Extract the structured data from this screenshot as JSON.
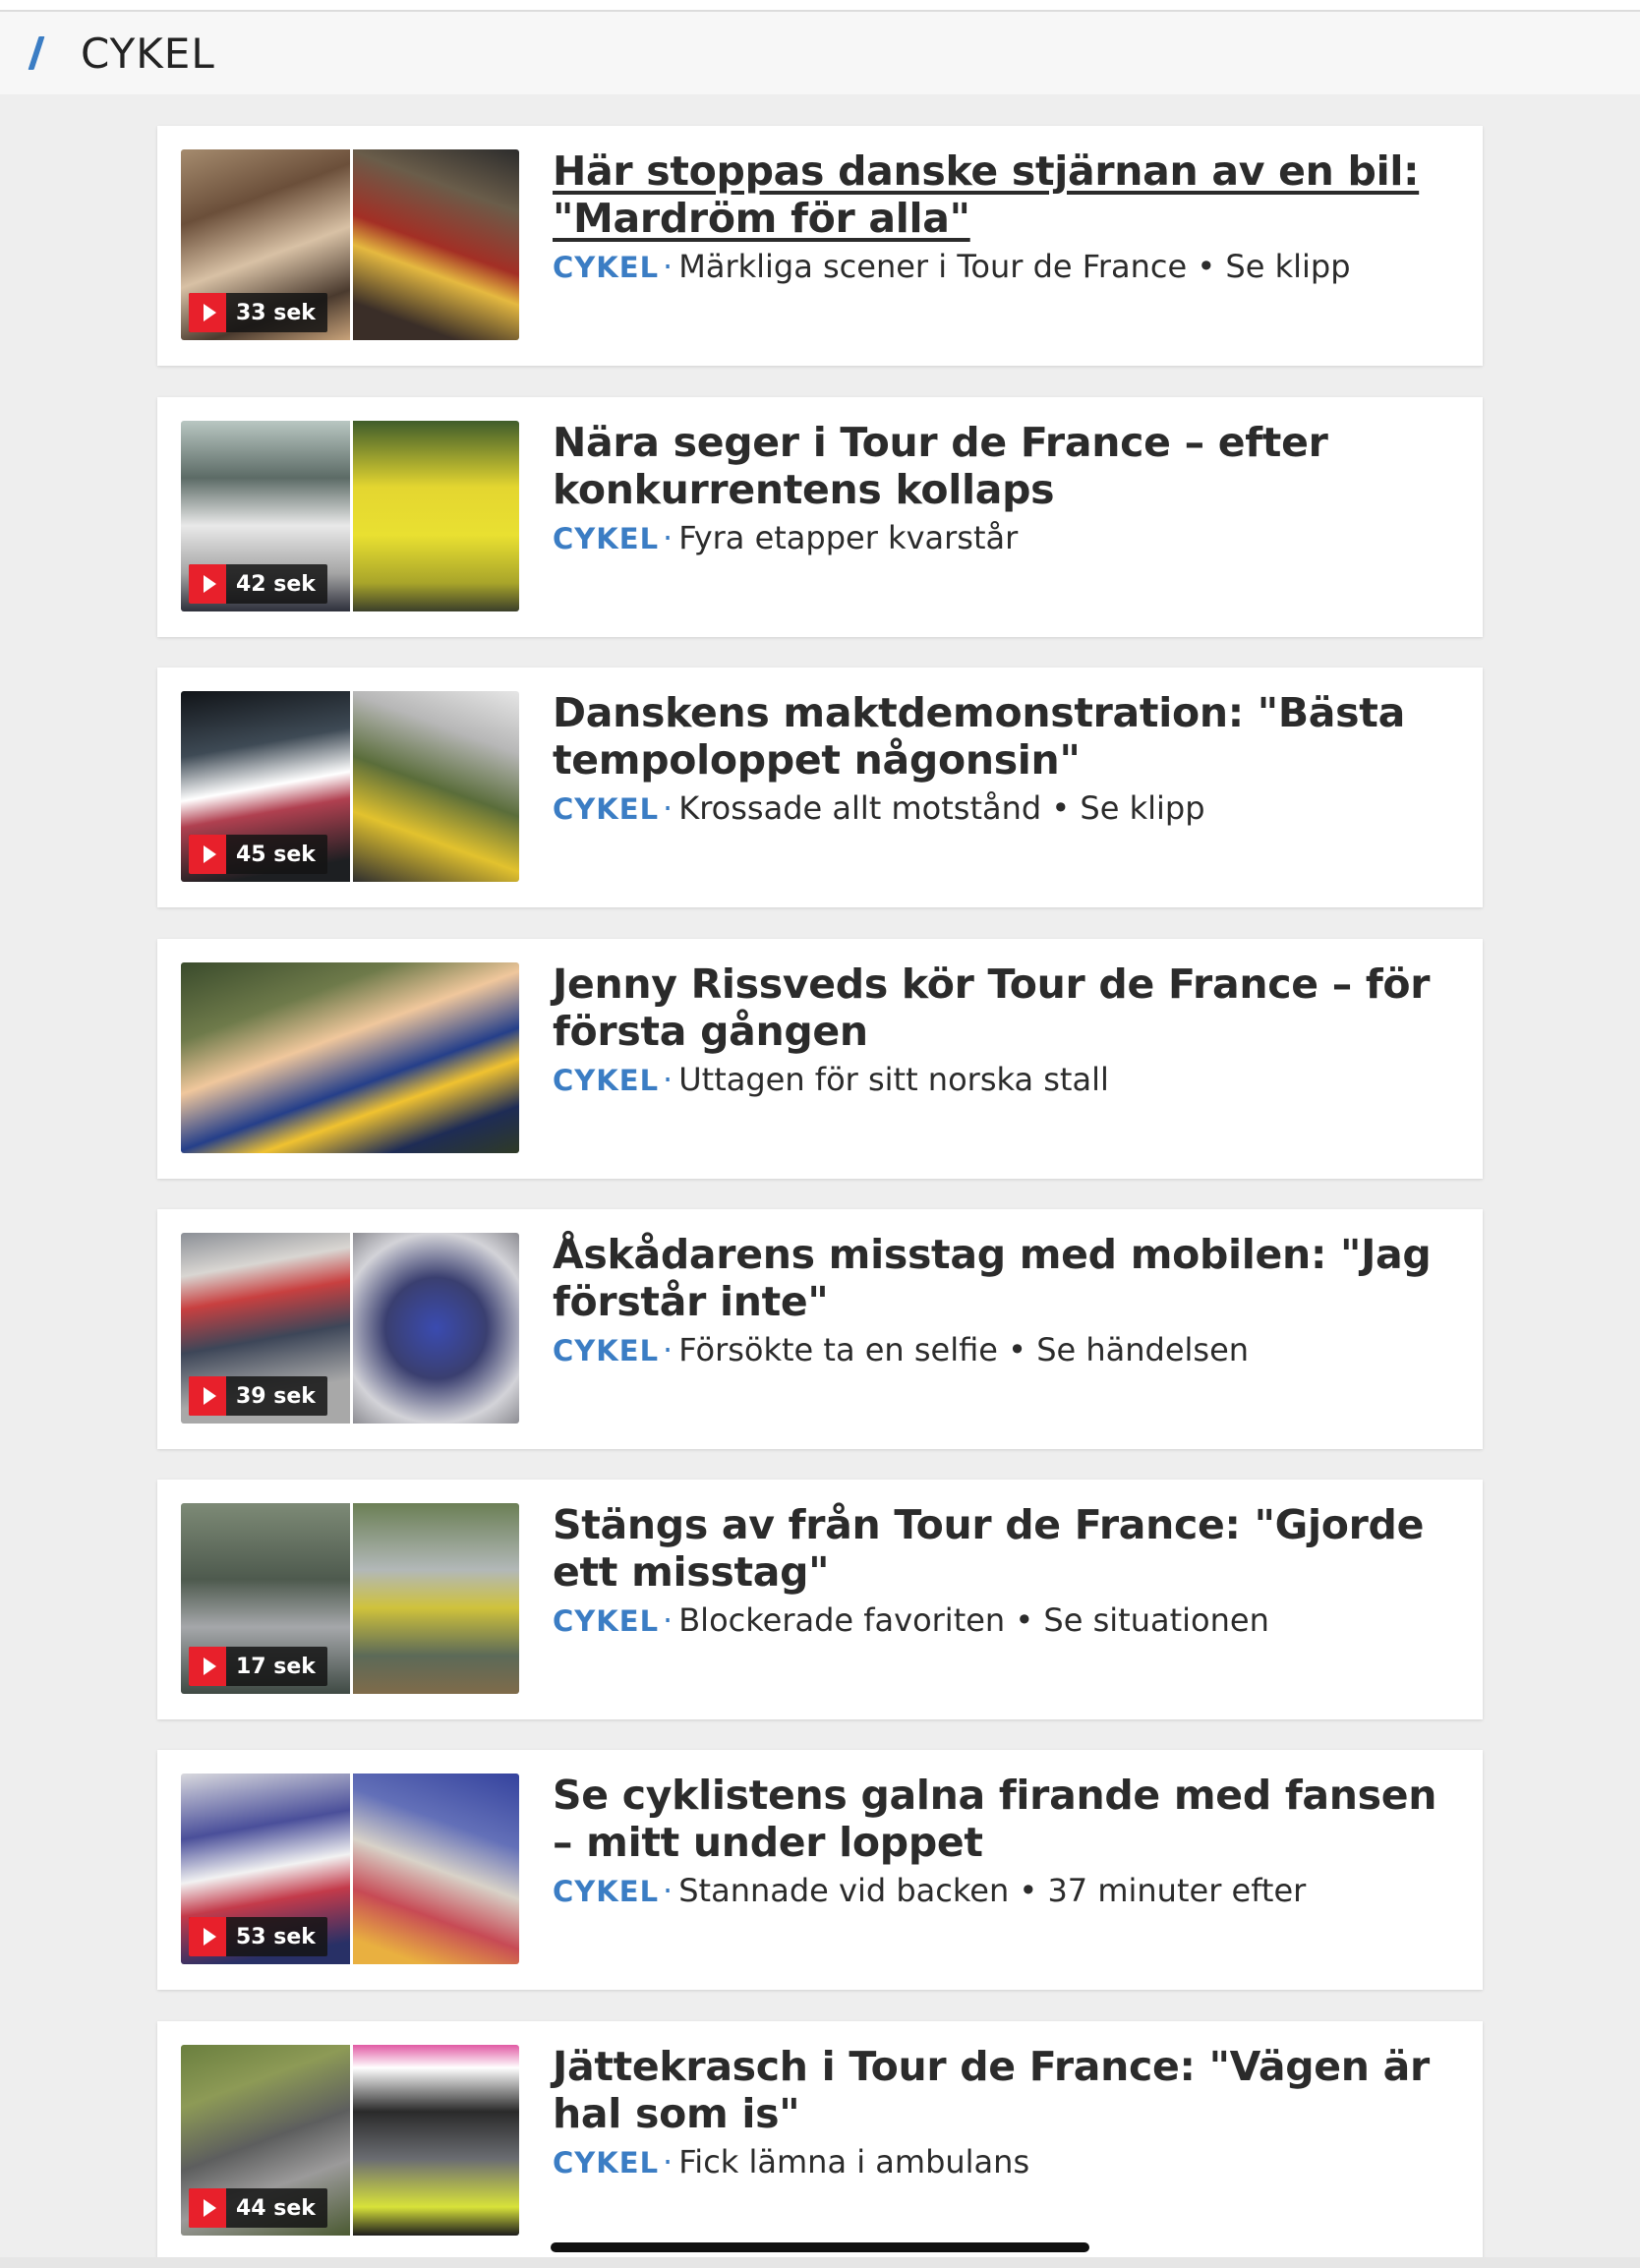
{
  "section": {
    "title": "CYKEL"
  },
  "articles": [
    {
      "headline": "Här stoppas danske stjärnan av en bil: \"Mardröm för alla\"",
      "category": "CYKEL",
      "subtitle": "Märkliga scener i Tour de France • Se klipp",
      "duration": "33 sek"
    },
    {
      "headline": "Nära seger i Tour de France – efter konkurrentens kollaps",
      "category": "CYKEL",
      "subtitle": "Fyra etapper kvarstår",
      "duration": "42 sek"
    },
    {
      "headline": "Danskens maktdemonstration: \"Bästa tempoloppet någonsin\"",
      "category": "CYKEL",
      "subtitle": "Krossade allt motstånd • Se klipp",
      "duration": "45 sek"
    },
    {
      "headline": "Jenny Rissveds kör Tour de France – för första gången",
      "category": "CYKEL",
      "subtitle": "Uttagen för sitt norska stall",
      "duration": ""
    },
    {
      "headline": "Åskådarens misstag med mobilen: \"Jag förstår inte\"",
      "category": "CYKEL",
      "subtitle": "Försökte ta en selfie • Se händelsen",
      "duration": "39 sek"
    },
    {
      "headline": "Stängs av från Tour de France: \"Gjorde ett misstag\"",
      "category": "CYKEL",
      "subtitle": "Blockerade favoriten • Se situationen",
      "duration": "17 sek"
    },
    {
      "headline": "Se cyklistens galna firande med fansen – mitt under loppet",
      "category": "CYKEL",
      "subtitle": "Stannade vid backen • 37 minuter efter",
      "duration": "53 sek"
    },
    {
      "headline": "Jättekrasch i Tour de France: \"Vägen är hal som is\"",
      "category": "CYKEL",
      "subtitle": "Fick lämna i ambulans",
      "duration": "44 sek"
    }
  ],
  "colors": {
    "accent": "#3b7dc4",
    "play": "#e8202b",
    "background": "#eeeeee"
  },
  "icons": {
    "section": "slash-icon",
    "video": "play-icon"
  }
}
